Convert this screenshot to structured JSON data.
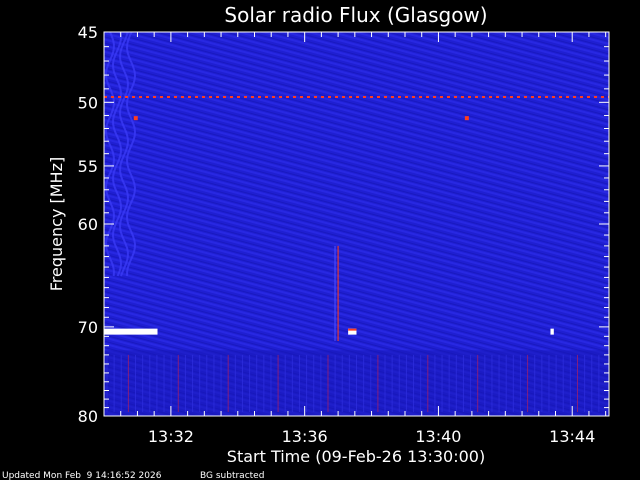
{
  "chart_data": {
    "type": "heatmap",
    "title": "Solar radio Flux (Glasgow)",
    "xlabel": "Start Time (09-Feb-26 13:30:00)",
    "ylabel": "Frequency [MHz]",
    "x_ticks": [
      "13:32",
      "13:36",
      "13:40",
      "13:44"
    ],
    "x_tick_minutes": [
      2,
      6,
      10,
      14
    ],
    "xlim_minutes": [
      0,
      15.1
    ],
    "y_ticks": [
      45,
      50,
      55,
      60,
      70,
      80
    ],
    "ylim": [
      45,
      80
    ],
    "y_scale": "log",
    "background_color": "#1f1fd2",
    "line_color": "#ff3c1e",
    "features": [
      {
        "kind": "band",
        "freq": 49.6,
        "t0": 0.0,
        "t1": 15.1,
        "color": "#ff3c1e"
      },
      {
        "kind": "dot",
        "freq": 51.2,
        "t": 0.95,
        "color": "#ff3c1e"
      },
      {
        "kind": "dot",
        "freq": 51.2,
        "t": 10.85,
        "color": "#ff3c1e"
      },
      {
        "kind": "block",
        "freq": 70.5,
        "t0": 0.0,
        "t1": 1.6,
        "color": "#ffffff"
      },
      {
        "kind": "block",
        "freq": 70.5,
        "t0": 7.3,
        "t1": 7.55,
        "color": "#ffffff"
      },
      {
        "kind": "block",
        "freq": 70.5,
        "t0": 13.35,
        "t1": 13.45,
        "color": "#ffffff"
      },
      {
        "kind": "vertical",
        "t": 7.0,
        "f0": 62.0,
        "f1": 71.5,
        "color": "#ff3c1e"
      }
    ]
  },
  "footer": {
    "updated": "Updated Mon Feb  9 14:16:52 2026",
    "bg": "BG subtracted"
  }
}
